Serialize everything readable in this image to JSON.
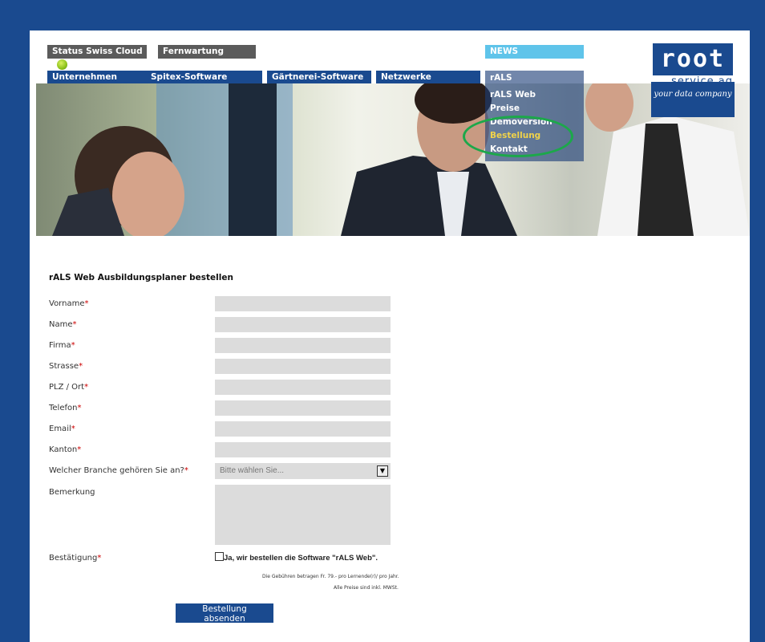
{
  "topnav": {
    "status_label": "Status Swiss Cloud",
    "fernwartung": "Fernwartung",
    "news": "NEWS",
    "items": [
      "Unternehmen",
      "Spitex-Software",
      "Gärtnerei-Software",
      "Netzwerke",
      "rALS"
    ]
  },
  "logo": {
    "word": "root",
    "service": "service ag",
    "tagline": "your data company"
  },
  "dropdown": {
    "items": [
      "rALS Web",
      "Preise",
      "Demoversion",
      "Bestellung",
      "Kontakt"
    ],
    "active": "Bestellung"
  },
  "form": {
    "title": "rALS Web Ausbildungsplaner bestellen",
    "fields": [
      "Vorname",
      "Name",
      "Firma",
      "Strasse",
      "PLZ / Ort",
      "Telefon",
      "Email",
      "Kanton"
    ],
    "required_mark": "*",
    "branche_label": "Welcher Branche gehören Sie an?",
    "branche_placeholder": "Bitte wählen Sie...",
    "bemerkung_label": "Bemerkung",
    "bestaetigung_label": "Bestätigung",
    "checkbox_text": "Ja, wir bestellen die Software \"rALS Web\".",
    "fee_note": "Die Gebühren betragen Fr. 79.- pro Lernende(r)/ pro Jahr.",
    "vat_note": "Alle Preise sind inkl. MWSt.",
    "submit": "Bestellung absenden"
  },
  "colors": {
    "brand": "#1a4a8f",
    "news": "#5fc4ea",
    "gray_tab": "#5b5b5b",
    "highlight_ring": "#1ca84a",
    "active_menu": "#f0d24a"
  }
}
